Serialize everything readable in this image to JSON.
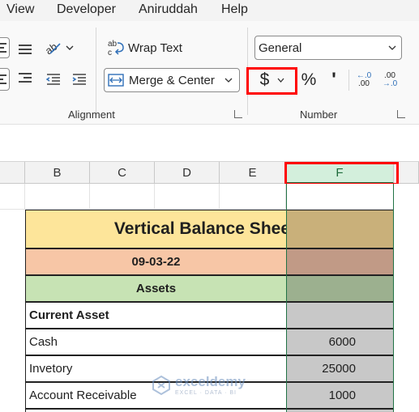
{
  "menu": {
    "items": [
      "View",
      "Developer",
      "Aniruddah",
      "Help"
    ]
  },
  "ribbon": {
    "alignment": {
      "wrap_text": "Wrap Text",
      "merge_center": "Merge & Center",
      "group_label": "Alignment"
    },
    "number": {
      "format_value": "General",
      "currency_symbol": "$",
      "percent_symbol": "%",
      "comma_symbol": "'",
      "increase_decimal_top": "←.0",
      "increase_decimal_bottom": ".00",
      "decrease_decimal_top": ".00",
      "decrease_decimal_bottom": "→.0",
      "group_label": "Number"
    }
  },
  "columns": [
    "B",
    "C",
    "D",
    "E",
    "F"
  ],
  "selected_column": "F",
  "sheet": {
    "title": "Vertical Balance Sheet",
    "date": "09-03-22",
    "section": "Assets",
    "subsection": "Current Asset",
    "rows": [
      {
        "label": "Cash",
        "value": "6000"
      },
      {
        "label": "Invetory",
        "value": "25000"
      },
      {
        "label": "Account Receivable",
        "value": "1000"
      }
    ]
  },
  "colors": {
    "title_bg": "#fde59a",
    "title_bg_selected": "#c9b07a",
    "date_bg": "#f7c6a6",
    "date_bg_selected": "#c19a86",
    "section_bg": "#c7e3b4",
    "section_bg_selected": "#9cb08f",
    "selected_col_bg": "#c8c8c8",
    "highlight_red": "#ff0000",
    "excel_green": "#217346"
  },
  "watermark": {
    "name": "exceldemy",
    "tagline": "EXCEL · DATA · BI"
  }
}
